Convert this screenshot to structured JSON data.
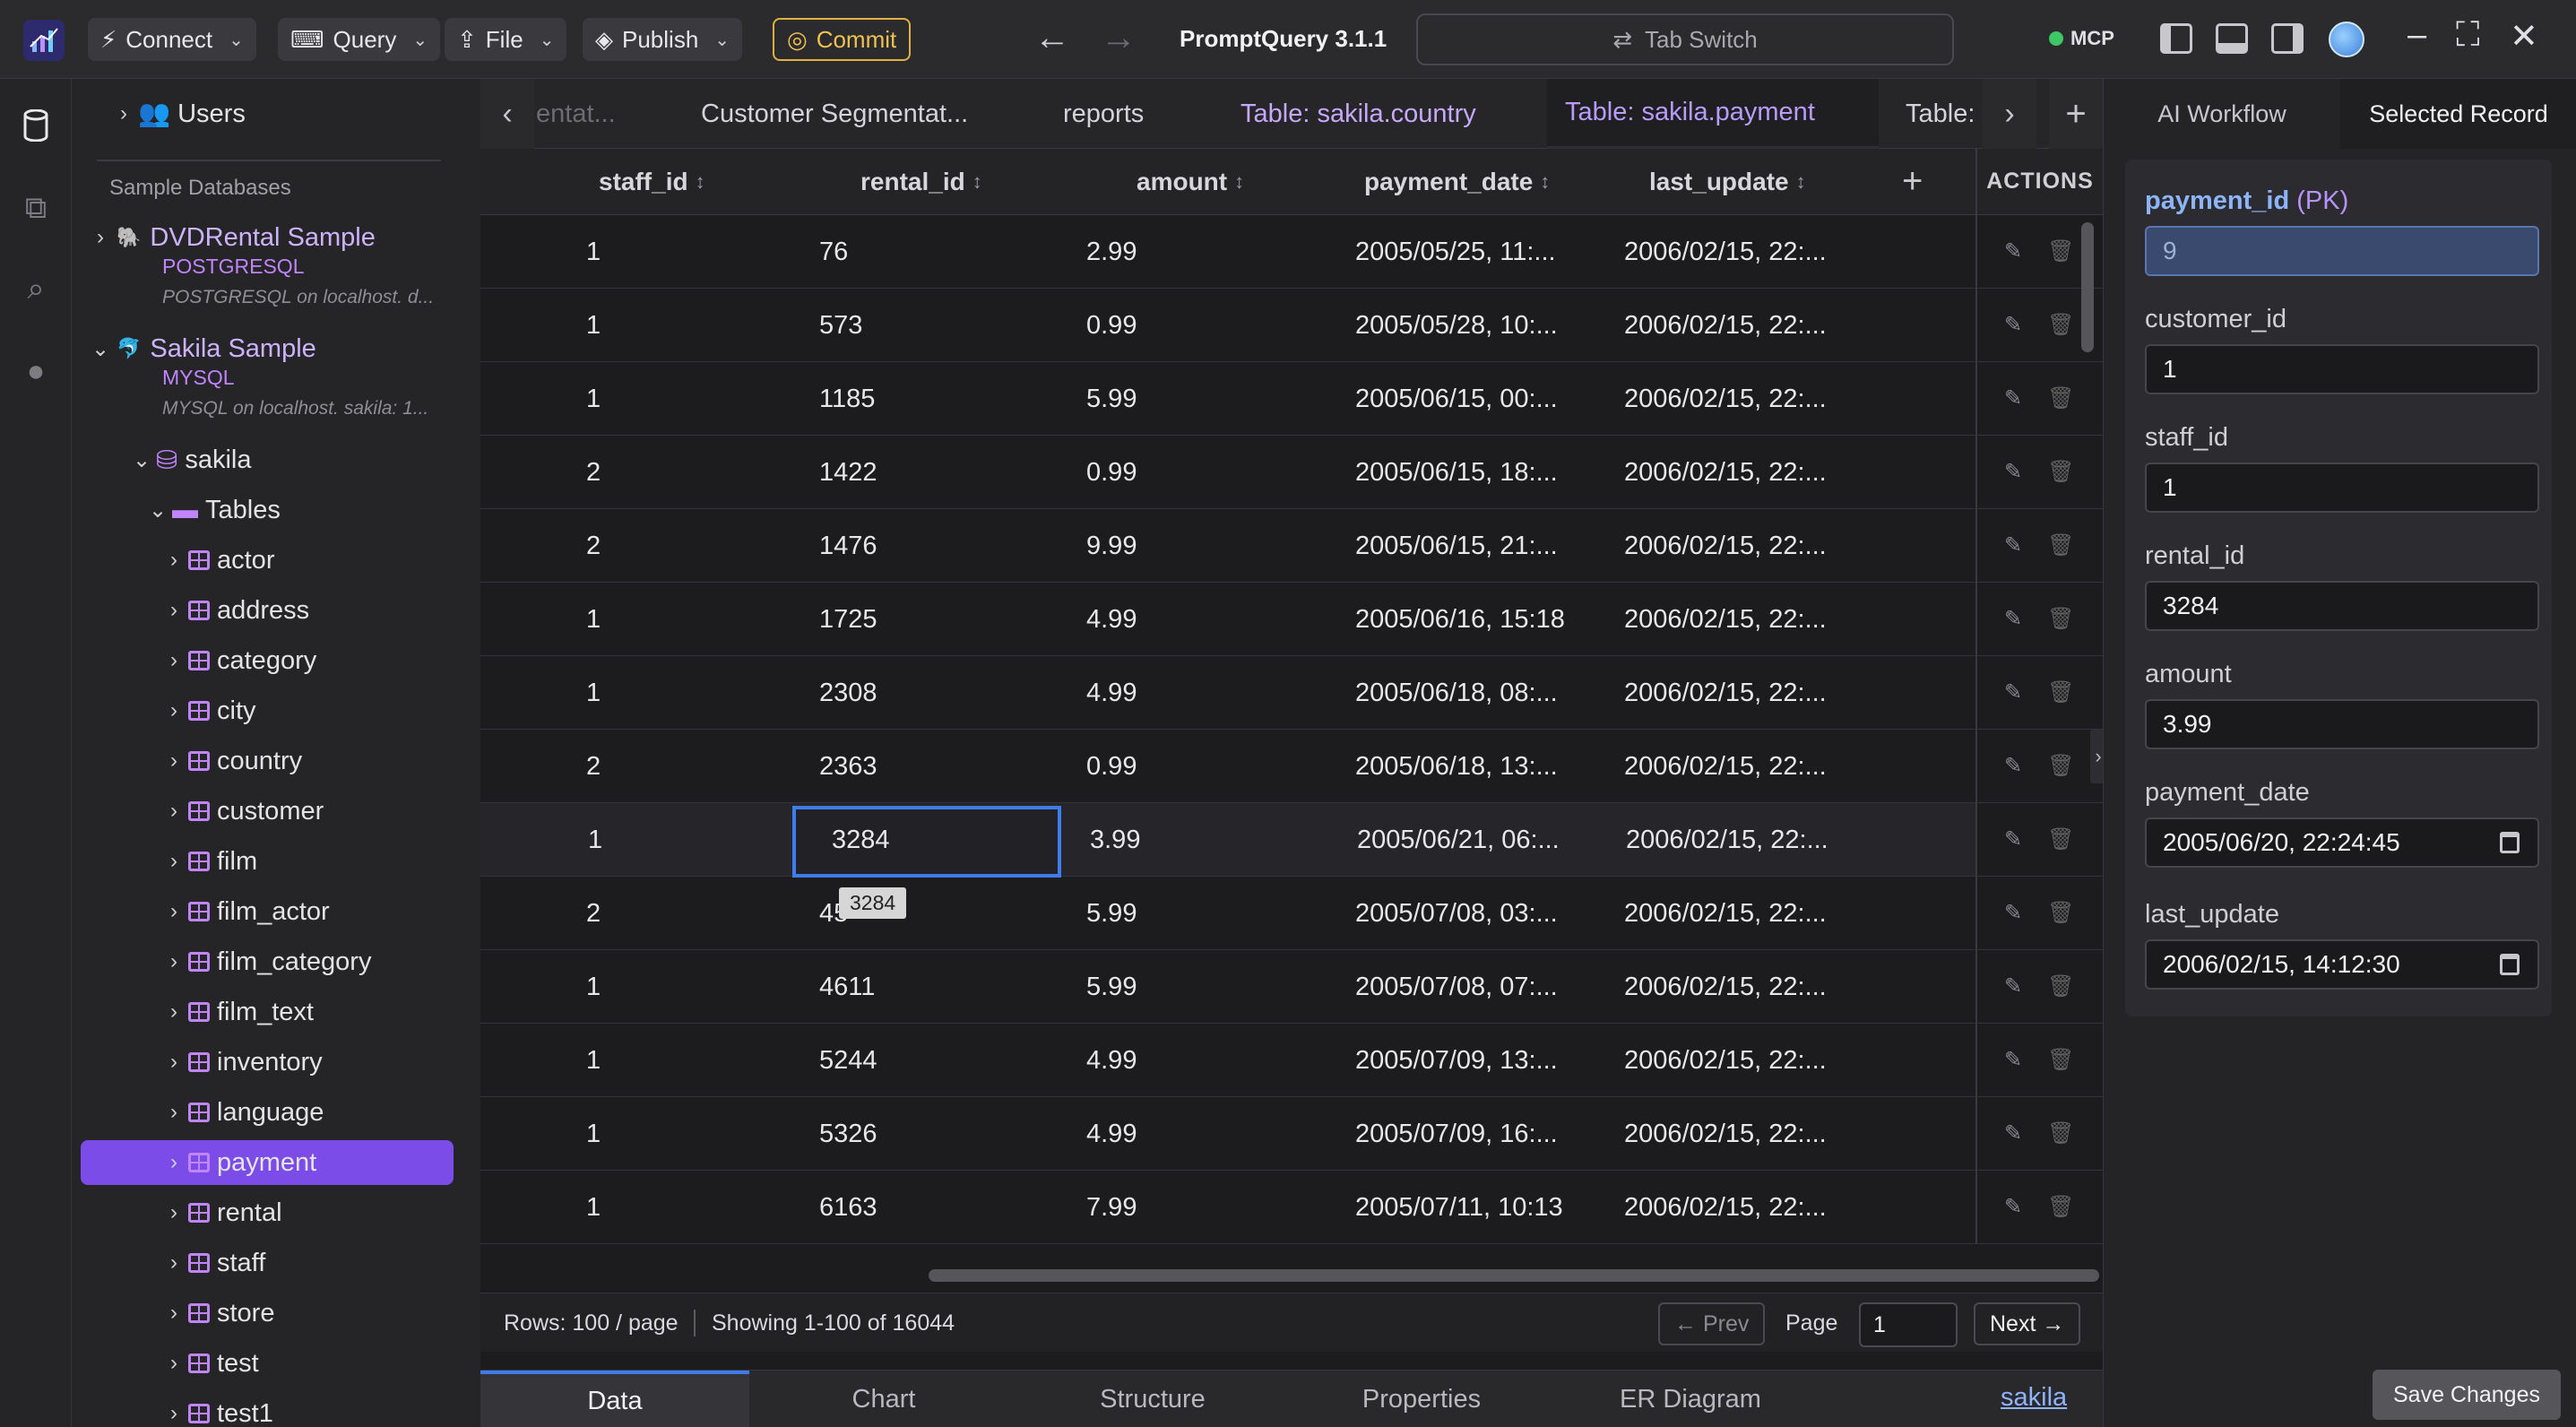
{
  "topbar": {
    "connect": "Connect",
    "query": "Query",
    "file": "File",
    "publish": "Publish",
    "commit": "Commit",
    "app_title": "PromptQuery 3.1.1",
    "tab_switch": "Tab Switch",
    "mcp": "MCP"
  },
  "sidebar": {
    "users": "Users",
    "section_label": "Sample Databases",
    "dvd": {
      "title": "DVDRental Sample",
      "type": "POSTGRESQL",
      "desc": "POSTGRESQL on localhost. d..."
    },
    "sakila": {
      "title": "Sakila Sample",
      "type": "MYSQL",
      "desc": "MYSQL on localhost. sakila: 1..."
    },
    "schema": "sakila",
    "tables_folder": "Tables",
    "tables": [
      "actor",
      "address",
      "category",
      "city",
      "country",
      "customer",
      "film",
      "film_actor",
      "film_category",
      "film_text",
      "inventory",
      "language",
      "payment",
      "rental",
      "staff",
      "store",
      "test",
      "test1"
    ],
    "selected_table": "payment"
  },
  "tabs": [
    {
      "label": "entat..."
    },
    {
      "label": "Customer Segmentat..."
    },
    {
      "label": "reports"
    },
    {
      "label": "Table: sakila.country"
    },
    {
      "label": "Table: sakila.payment"
    },
    {
      "label": "Table:"
    }
  ],
  "grid": {
    "columns": [
      "staff_id",
      "rental_id",
      "amount",
      "payment_date",
      "last_update"
    ],
    "actions_header": "ACTIONS",
    "rows": [
      [
        "1",
        "76",
        "2.99",
        "2005/05/25, 11:...",
        "2006/02/15, 22:..."
      ],
      [
        "1",
        "573",
        "0.99",
        "2005/05/28, 10:...",
        "2006/02/15, 22:..."
      ],
      [
        "1",
        "1185",
        "5.99",
        "2005/06/15, 00:...",
        "2006/02/15, 22:..."
      ],
      [
        "2",
        "1422",
        "0.99",
        "2005/06/15, 18:...",
        "2006/02/15, 22:..."
      ],
      [
        "2",
        "1476",
        "9.99",
        "2005/06/15, 21:...",
        "2006/02/15, 22:..."
      ],
      [
        "1",
        "1725",
        "4.99",
        "2005/06/16, 15:18",
        "2006/02/15, 22:..."
      ],
      [
        "1",
        "2308",
        "4.99",
        "2005/06/18, 08:...",
        "2006/02/15, 22:..."
      ],
      [
        "2",
        "2363",
        "0.99",
        "2005/06/18, 13:...",
        "2006/02/15, 22:..."
      ],
      [
        "1",
        "3284",
        "3.99",
        "2005/06/21, 06:...",
        "2006/02/15, 22:..."
      ],
      [
        "2",
        "45",
        "5.99",
        "2005/07/08, 03:...",
        "2006/02/15, 22:..."
      ],
      [
        "1",
        "4611",
        "5.99",
        "2005/07/08, 07:...",
        "2006/02/15, 22:..."
      ],
      [
        "1",
        "5244",
        "4.99",
        "2005/07/09, 13:...",
        "2006/02/15, 22:..."
      ],
      [
        "1",
        "5326",
        "4.99",
        "2005/07/09, 16:...",
        "2006/02/15, 22:..."
      ],
      [
        "1",
        "6163",
        "7.99",
        "2005/07/11, 10:13",
        "2006/02/15, 22:..."
      ]
    ],
    "selected_row_index": 8,
    "tooltip": "3284"
  },
  "footer": {
    "rows_per_page": "Rows: 100 / page",
    "showing": "Showing 1-100 of 16044",
    "prev": "← Prev",
    "page_label": "Page",
    "page_value": "1",
    "next": "Next →"
  },
  "bottom_tabs": {
    "data": "Data",
    "chart": "Chart",
    "structure": "Structure",
    "properties": "Properties",
    "er": "ER Diagram",
    "db_link": "sakila"
  },
  "rpanel": {
    "tab_workflow": "AI Workflow",
    "tab_record": "Selected Record",
    "pk_name": "payment_id",
    "pk_tag": "(PK)",
    "fields": [
      {
        "label": "payment_id",
        "value": "9"
      },
      {
        "label": "customer_id",
        "value": "1"
      },
      {
        "label": "staff_id",
        "value": "1"
      },
      {
        "label": "rental_id",
        "value": "3284"
      },
      {
        "label": "amount",
        "value": "3.99"
      },
      {
        "label": "payment_date",
        "value": "2005/06/20, 22:24:45"
      },
      {
        "label": "last_update",
        "value": "2006/02/15, 14:12:30"
      }
    ],
    "save": "Save Changes"
  },
  "colors": {
    "accent": "#7c4ce8",
    "selection_border": "#3f7cf0",
    "commit": "#e0b040"
  }
}
